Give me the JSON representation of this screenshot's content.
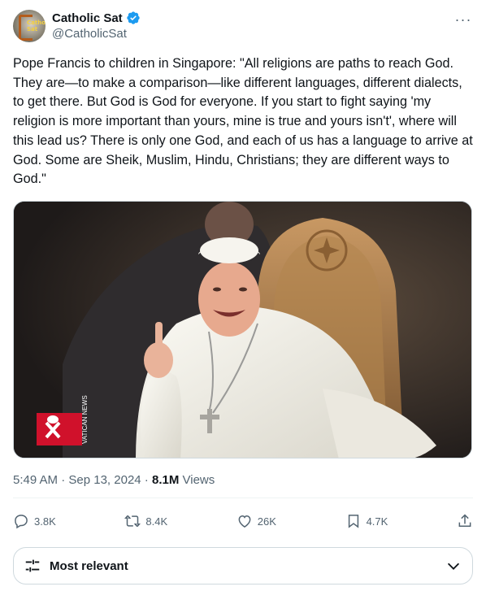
{
  "author": {
    "display_name": "Catholic Sat",
    "handle": "@CatholicSat",
    "avatar_text": "Catholic Sat",
    "verified": true,
    "verified_color": "#1d9bf0"
  },
  "more_label": "···",
  "tweet": {
    "text": "Pope Francis to children in Singapore: \"All religions are paths to reach God. They are—to make a comparison—like different languages, different dialects, to get there. But God is God for everyone. If you start to fight saying 'my religion is more important than yours, mine is true and yours isn't', where will this lead us? There is only one God, and each of us has a language to arrive at God. Some are Sheik, Muslim, Hindu, Christians; they are different ways to God.\"",
    "media_watermark": "VATICAN NEWS"
  },
  "meta": {
    "time": "5:49 AM",
    "separator": " · ",
    "date": "Sep 13, 2024",
    "views_count": "8.1M",
    "views_label": " Views"
  },
  "actions": {
    "replies": "3.8K",
    "reposts": "8.4K",
    "likes": "26K",
    "bookmarks": "4.7K"
  },
  "sort": {
    "label": "Most relevant"
  }
}
